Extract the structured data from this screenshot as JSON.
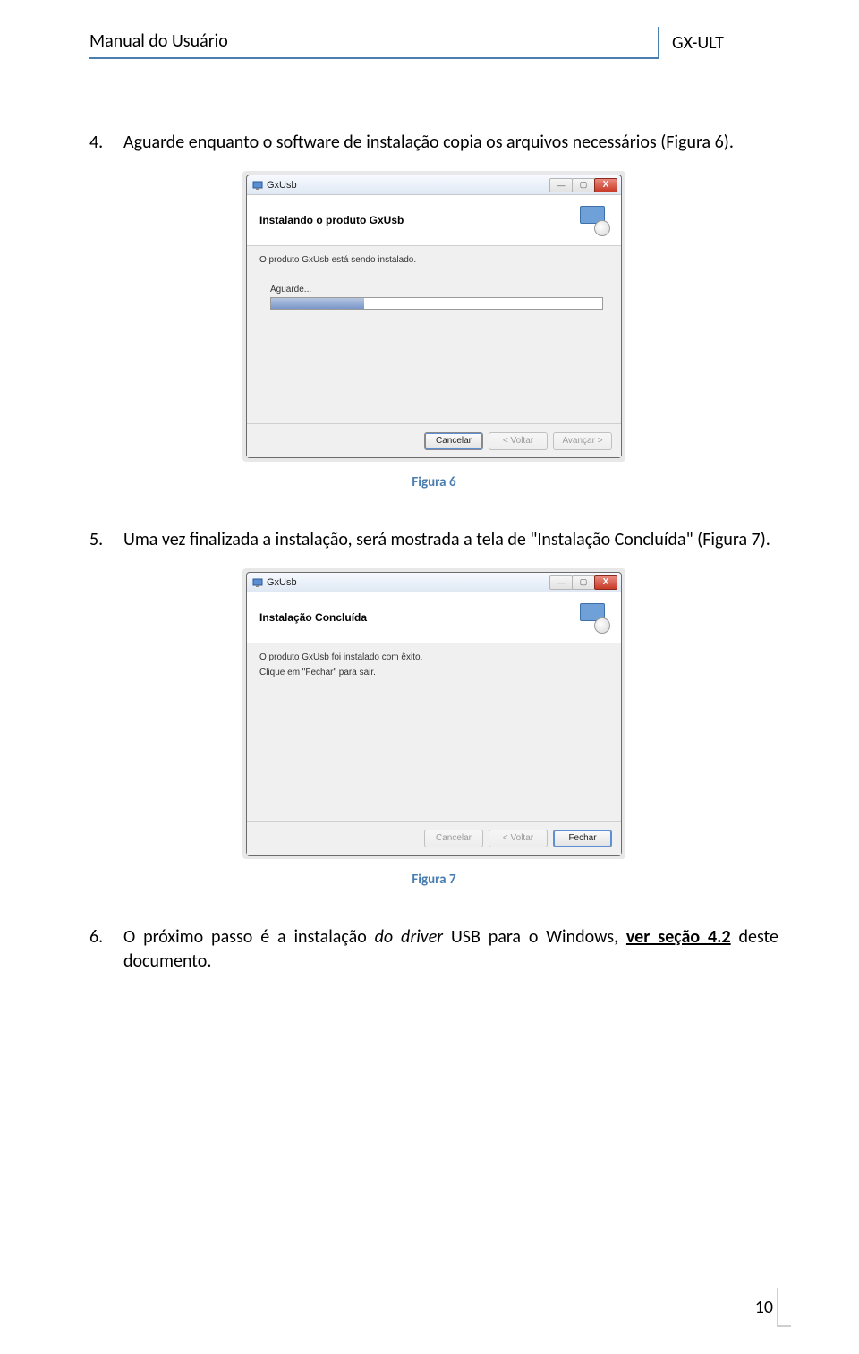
{
  "header": {
    "left": "Manual do Usuário",
    "right": "GX-ULT"
  },
  "steps": {
    "s4": {
      "num": "4.",
      "text": "Aguarde enquanto o software de instalação copia os arquivos necessários (Figura 6)."
    },
    "s5": {
      "num": "5.",
      "text": "Uma vez finalizada a instalação, será mostrada a tela de \"Instalação Concluída\" (Figura 7)."
    },
    "s6": {
      "num": "6.",
      "pre": "O próximo passo é a instalação ",
      "italic": "do driver",
      "mid": " USB para o Windows, ",
      "underline": "ver seção 4.2",
      "post": " deste documento."
    }
  },
  "captions": {
    "fig6": "Figura 6",
    "fig7": "Figura 7"
  },
  "dialog1": {
    "title": "GxUsb",
    "heading": "Instalando o produto GxUsb",
    "line1": "O produto GxUsb está sendo instalado.",
    "wait": "Aguarde...",
    "buttons": {
      "cancel": "Cancelar",
      "back": "< Voltar",
      "next": "Avançar >"
    }
  },
  "dialog2": {
    "title": "GxUsb",
    "heading": "Instalação Concluída",
    "line1": "O produto GxUsb foi instalado com êxito.",
    "line2": "Clique em \"Fechar\" para sair.",
    "buttons": {
      "cancel": "Cancelar",
      "back": "< Voltar",
      "close": "Fechar"
    }
  },
  "pageNumber": "10"
}
